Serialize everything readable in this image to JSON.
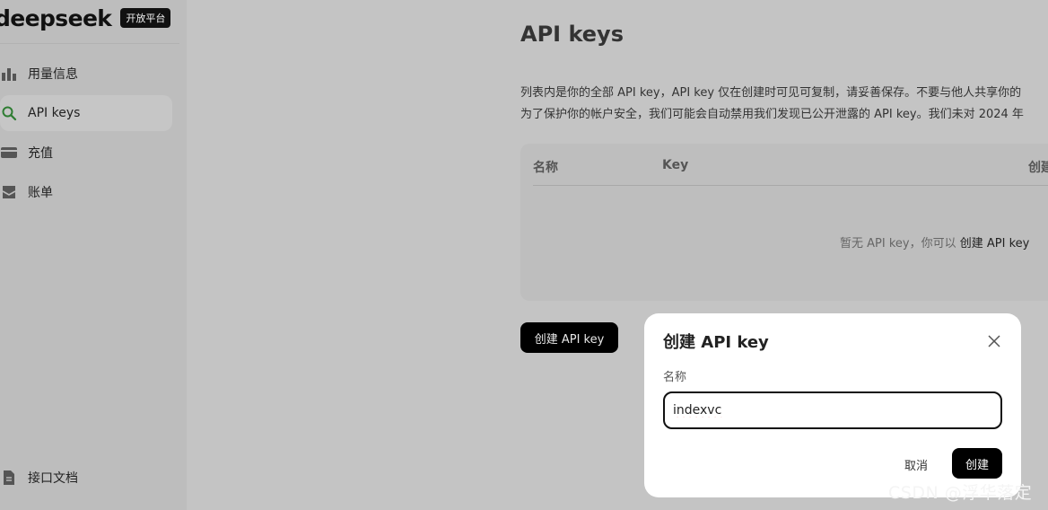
{
  "brand": {
    "name": "deepseek",
    "badge": "开放平台"
  },
  "sidebar": {
    "items": [
      {
        "label": "用量信息",
        "icon": "bar-chart-icon",
        "active": false
      },
      {
        "label": "API keys",
        "icon": "search-icon",
        "active": true
      },
      {
        "label": "充值",
        "icon": "wallet-icon",
        "active": false
      },
      {
        "label": "账单",
        "icon": "inbox-icon",
        "active": false
      }
    ],
    "footer_item": {
      "label": "接口文档",
      "icon": "document-icon"
    }
  },
  "main": {
    "title": "API keys",
    "description_lines": [
      "列表内是你的全部 API key，API key 仅在创建时可见可复制，请妥善保存。不要与他人共享你的",
      "为了保护你的帐户安全，我们可能会自动禁用我们发现已公开泄露的 API key。我们未对 2024 年"
    ],
    "table": {
      "columns": [
        "名称",
        "Key",
        "创建"
      ],
      "empty_text": "暂无 API key，你可以",
      "empty_link": "创建 API key"
    },
    "create_button": "创建 API key"
  },
  "modal": {
    "title": "创建 API key",
    "field_label": "名称",
    "input_value": "indexvc",
    "cancel": "取消",
    "confirm": "创建"
  },
  "watermark": "CSDN @浮华落定",
  "colors": {
    "accent": "#2e7d32",
    "primary_button": "#000000",
    "overlay": "#c4c4c4"
  }
}
